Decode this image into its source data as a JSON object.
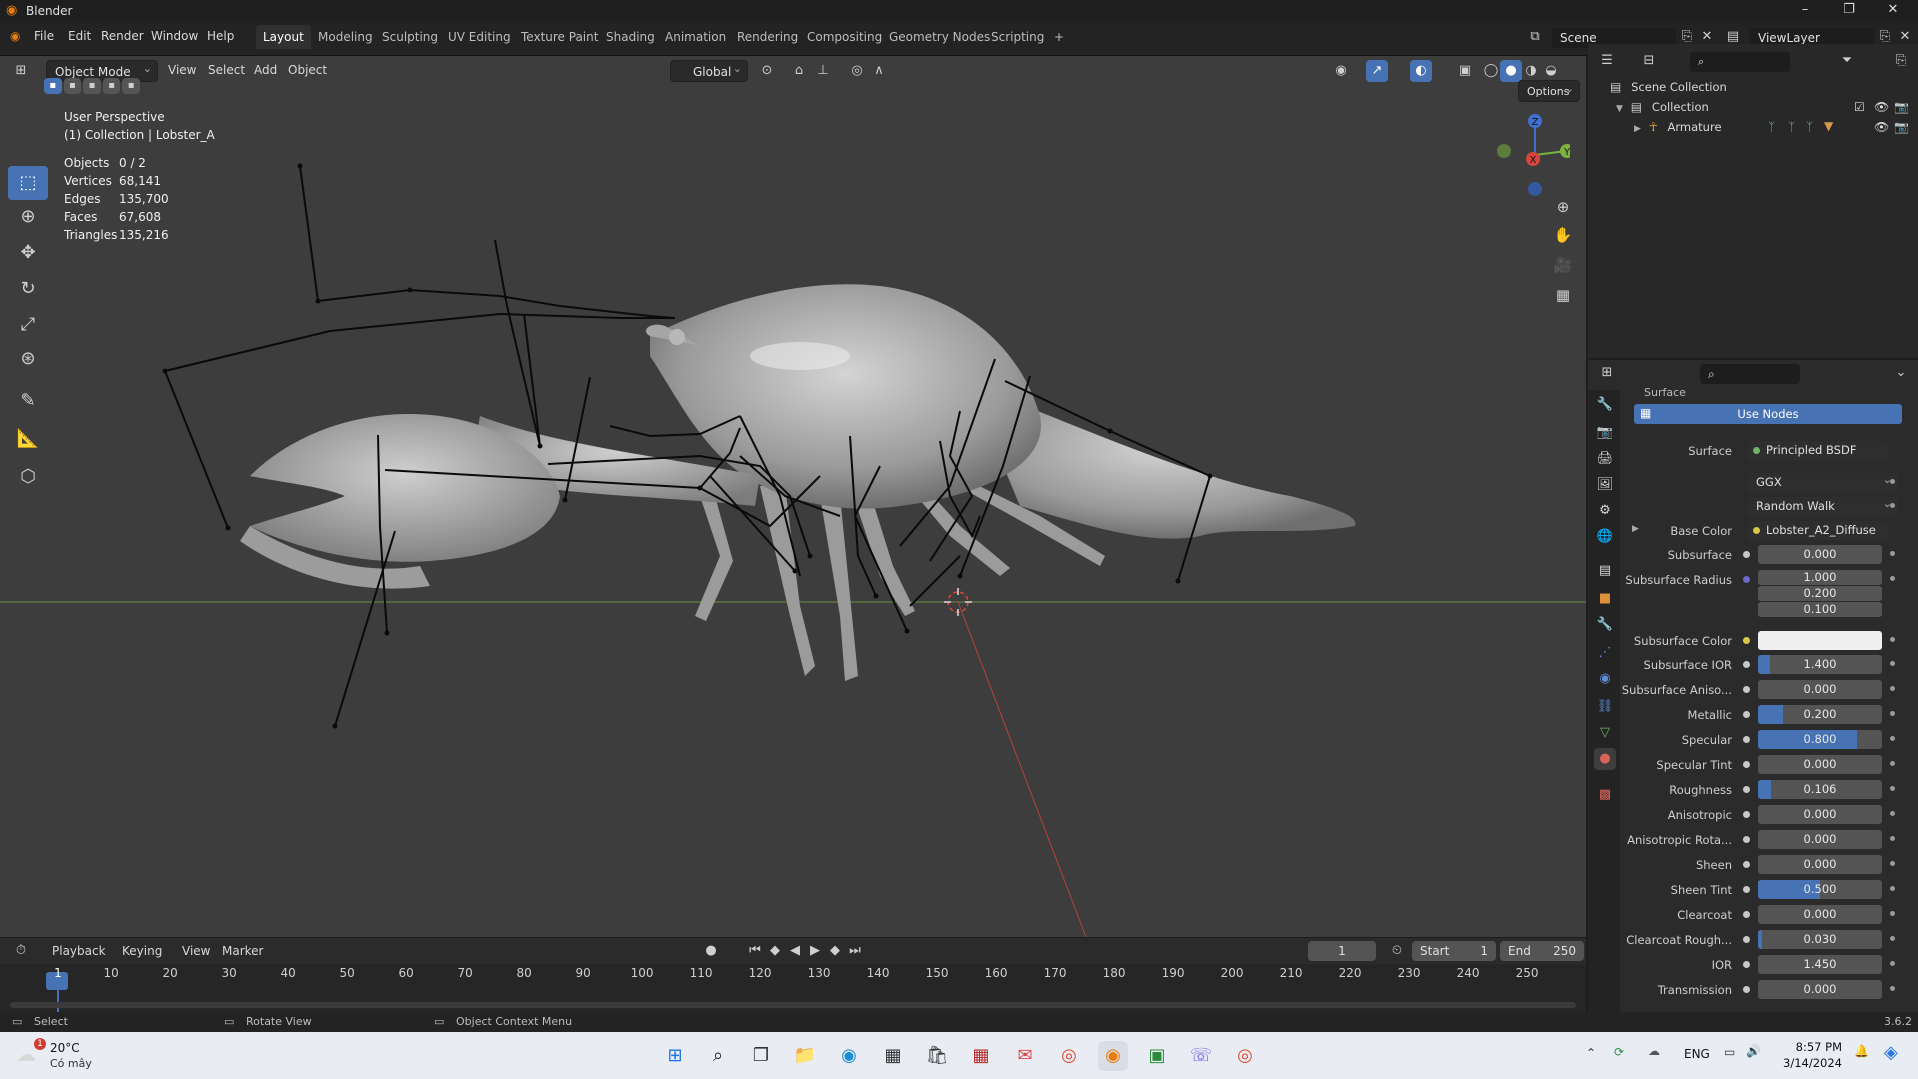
{
  "window": {
    "title": "Blender",
    "minimize": "–",
    "maximize": "❐",
    "close": "✕"
  },
  "menu": {
    "items": [
      "File",
      "Edit",
      "Render",
      "Window",
      "Help"
    ]
  },
  "workspaces": {
    "tabs": [
      "Layout",
      "Modeling",
      "Sculpting",
      "UV Editing",
      "Texture Paint",
      "Shading",
      "Animation",
      "Rendering",
      "Compositing",
      "Geometry Nodes",
      "Scripting"
    ],
    "active": "Layout",
    "add": "+"
  },
  "scene": {
    "label": "Scene",
    "view_layer": "ViewLayer"
  },
  "viewport": {
    "mode": "Object Mode",
    "menus": [
      "View",
      "Select",
      "Add",
      "Object"
    ],
    "orientation": "Global",
    "options": "Options",
    "perspective": "User Perspective",
    "collection": "(1) Collection | Lobster_A",
    "stats": [
      {
        "k": "Objects",
        "v": "0 / 2"
      },
      {
        "k": "Vertices",
        "v": "68,141"
      },
      {
        "k": "Edges",
        "v": "135,700"
      },
      {
        "k": "Faces",
        "v": "67,608"
      },
      {
        "k": "Triangles",
        "v": "135,216"
      }
    ],
    "gizmo": {
      "z": "Z",
      "y": "Y",
      "x": "X"
    }
  },
  "outliner": {
    "items": [
      {
        "label": "Scene Collection"
      },
      {
        "label": "Collection"
      },
      {
        "label": "Armature"
      }
    ]
  },
  "properties": {
    "section": "Surface",
    "use_nodes": "Use Nodes",
    "surface_label": "Surface",
    "surface_value": "Principled BSDF",
    "distribution": "GGX",
    "subsurface_method": "Random Walk",
    "base_color_label": "Base Color",
    "base_color_value": "Lobster_A2_Diffuse",
    "rows": [
      {
        "label": "Subsurface",
        "value": "0.000",
        "fill": 0
      },
      {
        "label": "Subsurface Radius",
        "value": "1.000",
        "fill": 0
      },
      {
        "label": "",
        "value": "0.200",
        "fill": 0
      },
      {
        "label": "",
        "value": "0.100",
        "fill": 0
      },
      {
        "label": "Subsurface Color",
        "value": "",
        "fill": 0
      },
      {
        "label": "Subsurface IOR",
        "value": "1.400",
        "fill": 0.1
      },
      {
        "label": "Subsurface Aniso...",
        "value": "0.000",
        "fill": 0
      },
      {
        "label": "Metallic",
        "value": "0.200",
        "fill": 0.2
      },
      {
        "label": "Specular",
        "value": "0.800",
        "fill": 0.8
      },
      {
        "label": "Specular Tint",
        "value": "0.000",
        "fill": 0
      },
      {
        "label": "Roughness",
        "value": "0.106",
        "fill": 0.106
      },
      {
        "label": "Anisotropic",
        "value": "0.000",
        "fill": 0
      },
      {
        "label": "Anisotropic Rota...",
        "value": "0.000",
        "fill": 0
      },
      {
        "label": "Sheen",
        "value": "0.000",
        "fill": 0
      },
      {
        "label": "Sheen Tint",
        "value": "0.500",
        "fill": 0.5
      },
      {
        "label": "Clearcoat",
        "value": "0.000",
        "fill": 0
      },
      {
        "label": "Clearcoat Rough...",
        "value": "0.030",
        "fill": 0.03
      },
      {
        "label": "IOR",
        "value": "1.450",
        "fill": 0
      },
      {
        "label": "Transmission",
        "value": "0.000",
        "fill": 0
      }
    ]
  },
  "timeline": {
    "menus": [
      "Playback",
      "Keying",
      "View",
      "Marker"
    ],
    "current_frame": "1",
    "start_label": "Start",
    "start": "1",
    "end_label": "End",
    "end": "250",
    "frames": [
      "1",
      "10",
      "20",
      "30",
      "40",
      "50",
      "60",
      "70",
      "80",
      "90",
      "100",
      "110",
      "120",
      "130",
      "140",
      "150",
      "160",
      "170",
      "180",
      "190",
      "200",
      "210",
      "220",
      "230",
      "240",
      "250"
    ]
  },
  "status": {
    "select": "Select",
    "rotate": "Rotate View",
    "context": "Object Context Menu",
    "version": "3.6.2"
  },
  "taskbar": {
    "weather_temp": "20°C",
    "weather_desc": "Có mây",
    "lang": "ENG",
    "time": "8:57 PM",
    "date": "3/14/2024",
    "badge": "1"
  }
}
